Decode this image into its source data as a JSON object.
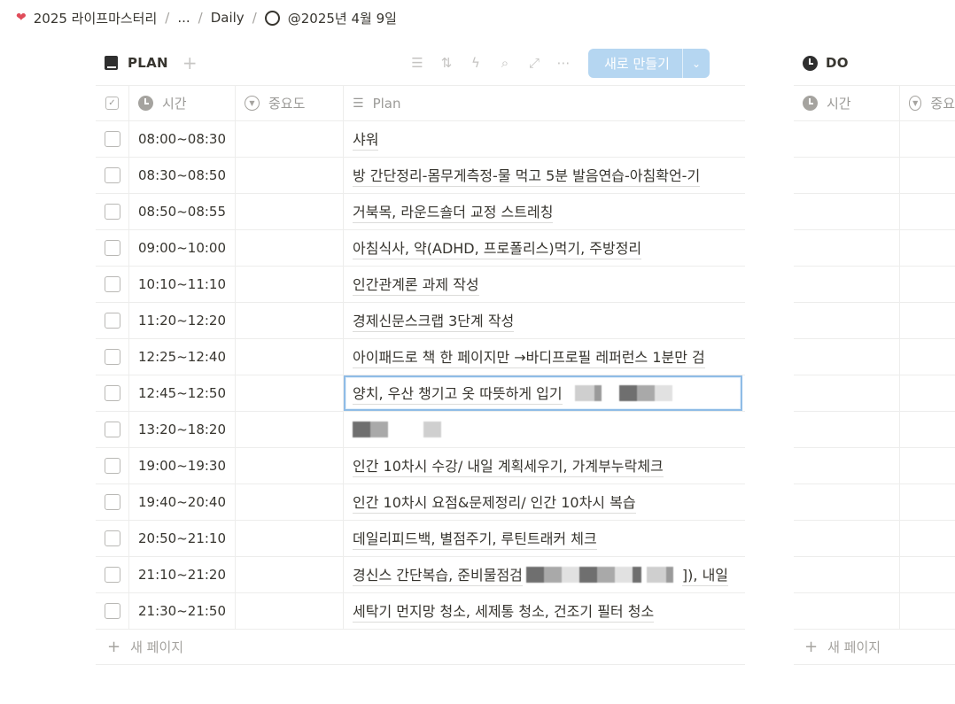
{
  "breadcrumb": {
    "workspace": "2025 라이프마스터리",
    "ellipsis": "...",
    "parent": "Daily",
    "current": "@2025년 4월 9일"
  },
  "plan_view": {
    "title": "PLAN",
    "new_button_label": "새로 만들기",
    "columns": {
      "time": "시간",
      "importance": "중요도",
      "plan": "Plan"
    },
    "rows": [
      {
        "time": "08:00~08:30",
        "plan": "샤워"
      },
      {
        "time": "08:30~08:50",
        "plan": "방 간단정리-몸무게측정-물 먹고 5분 발음연습-아침확언-기"
      },
      {
        "time": "08:50~08:55",
        "plan": "거북목, 라운드숄더 교정 스트레칭"
      },
      {
        "time": "09:00~10:00",
        "plan": "아침식사, 약(ADHD, 프로폴리스)먹기, 주방정리"
      },
      {
        "time": "10:10~11:10",
        "plan": "인간관계론 과제 작성"
      },
      {
        "time": "11:20~12:20",
        "plan": "경제신문스크랩 3단계 작성"
      },
      {
        "time": "12:25~12:40",
        "plan": "아이패드로 책 한 페이지만 →바디프로필 레퍼런스 1분만 검"
      },
      {
        "time": "12:45~12:50",
        "plan": "양치, 우산 챙기고 옷 따뜻하게 입기"
      },
      {
        "time": "13:20~18:20",
        "plan": ""
      },
      {
        "time": "19:00~19:30",
        "plan": "인간 10차시 수강/ 내일 계획세우기, 가계부누락체크"
      },
      {
        "time": "19:40~20:40",
        "plan": "인간 10차시 요점&문제정리/ 인간 10차시 복습"
      },
      {
        "time": "20:50~21:10",
        "plan": "데일리피드백, 별점주기, 루틴트래커 체크"
      },
      {
        "time": "21:10~21:20",
        "plan": "경신스 간단복습, 준비물점검",
        "plan_tail": "]), 내일"
      },
      {
        "time": "21:30~21:50",
        "plan": "세탁기 먼지망 청소, 세제통 청소, 건조기 필터 청소"
      }
    ],
    "new_page": "새 페이지"
  },
  "do_view": {
    "title": "DO",
    "columns": {
      "time": "시간",
      "importance": "중요"
    },
    "row_count": 14,
    "new_page": "새 페이지"
  },
  "colors": {
    "accent_button": "#b5d6f1",
    "heart": "#e04c5a",
    "text": "#37352f",
    "muted": "#9b9a97"
  },
  "icons": [
    "heart-icon",
    "circle-icon",
    "book-icon",
    "plus-icon",
    "filter-icon",
    "sort-icon",
    "lightning-icon",
    "search-icon",
    "expand-icon",
    "more-icon",
    "clock-icon",
    "select-icon",
    "list-icon",
    "checkbox-icon"
  ]
}
